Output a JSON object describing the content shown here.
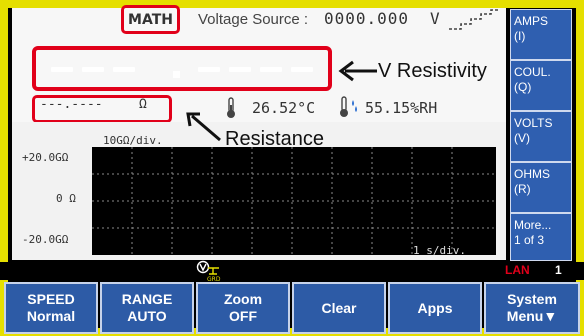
{
  "header": {
    "math_badge": "MATH",
    "voltage_source_label": "Voltage Source :",
    "voltage_source_value": "0000.000",
    "voltage_source_unit": "V"
  },
  "display": {
    "main_reading": "---.----",
    "resistance_value": "---.----",
    "resistance_unit": "Ω",
    "temperature": "26.52°C",
    "humidity": "55.15%RH"
  },
  "annotations": {
    "v_resistivity": "V Resistivity",
    "resistance": "Resistance"
  },
  "graph": {
    "scale_label": "10GΩ/div.",
    "y_top": "+20.0GΩ",
    "y_mid": "0 Ω",
    "y_bottom": "-20.0GΩ",
    "time_label": "1 s/div."
  },
  "side_keys": [
    {
      "line1": "AMPS",
      "line2": "(I)"
    },
    {
      "line1": "COUL.",
      "line2": "(Q)"
    },
    {
      "line1": "VOLTS",
      "line2": "(V)"
    },
    {
      "line1": "OHMS",
      "line2": "(R)"
    },
    {
      "line1": "More...",
      "line2": "1 of 3"
    }
  ],
  "status": {
    "lan_label": "LAN",
    "lan_count": "1"
  },
  "bottom_keys": [
    {
      "line1": "SPEED",
      "line2": "Normal"
    },
    {
      "line1": "RANGE",
      "line2": "AUTO"
    },
    {
      "line1": "Zoom",
      "line2": "OFF"
    },
    {
      "line1": "Clear",
      "line2": ""
    },
    {
      "line1": "Apps",
      "line2": ""
    },
    {
      "line1": "System",
      "line2": "Menu▼"
    }
  ],
  "colors": {
    "frame": "#e5df00",
    "highlight_red": "#e1001a",
    "softkey_blue": "#2d5ba6"
  }
}
